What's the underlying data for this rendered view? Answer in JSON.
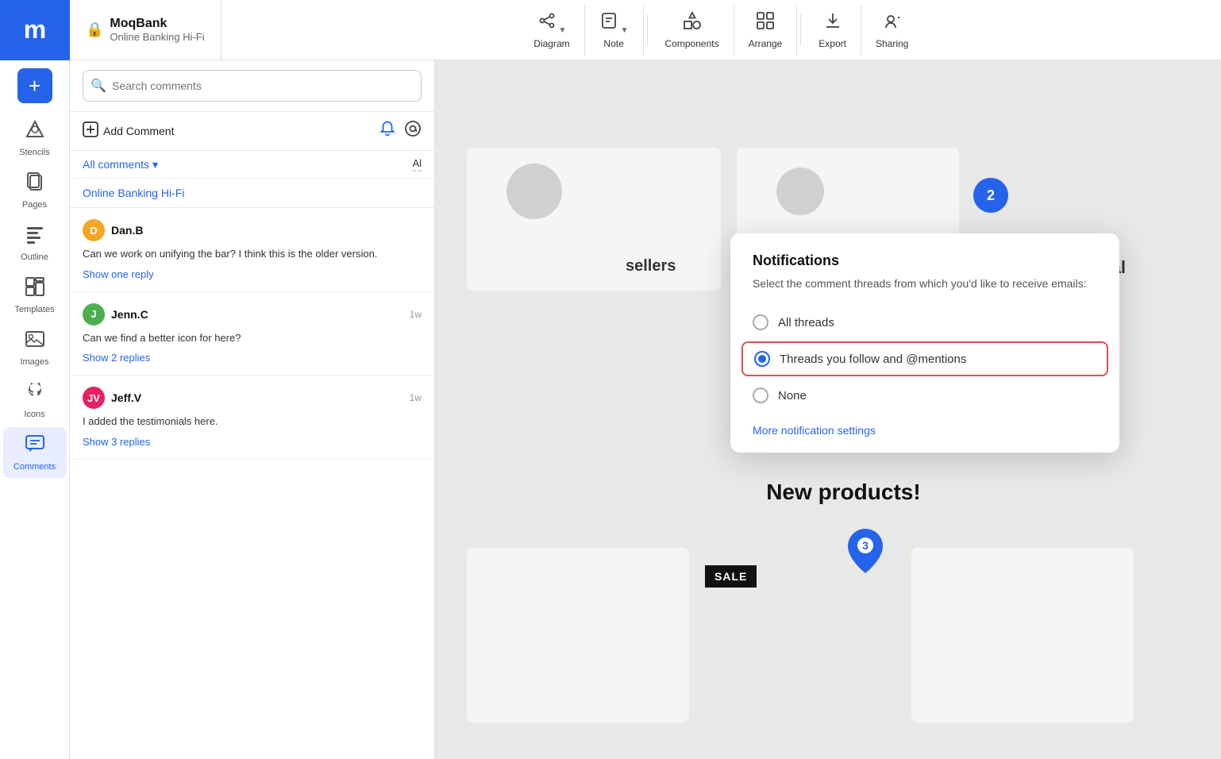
{
  "app": {
    "logo": "m",
    "project_name": "MoqBank",
    "project_sub": "Online Banking Hi-Fi",
    "lock_icon": "🔒"
  },
  "topbar": {
    "tools": [
      {
        "id": "diagram",
        "label": "Diagram",
        "icon": "⛓",
        "has_arrow": true
      },
      {
        "id": "note",
        "label": "Note",
        "icon": "📄",
        "has_arrow": true
      },
      {
        "id": "components",
        "label": "Components",
        "icon": "🔄"
      },
      {
        "id": "arrange",
        "label": "Arrange",
        "icon": "⊞"
      },
      {
        "id": "export",
        "label": "Export",
        "icon": "⬇"
      },
      {
        "id": "sharing",
        "label": "Sharing",
        "icon": "👤+"
      }
    ]
  },
  "sidebar": {
    "add_label": "+",
    "items": [
      {
        "id": "stencils",
        "label": "Stencils",
        "icon": "▲"
      },
      {
        "id": "pages",
        "label": "Pages",
        "icon": "📋"
      },
      {
        "id": "outline",
        "label": "Outline",
        "icon": "≡"
      },
      {
        "id": "templates",
        "label": "Templates",
        "icon": "⊞"
      },
      {
        "id": "images",
        "label": "Images",
        "icon": "🖼"
      },
      {
        "id": "icons",
        "label": "Icons",
        "icon": "♣"
      },
      {
        "id": "comments",
        "label": "Comments",
        "icon": "💬",
        "active": true
      }
    ]
  },
  "comments_panel": {
    "search_placeholder": "Search comments",
    "add_comment_label": "Add Comment",
    "all_comments_label": "All comments",
    "filter_label": "Al",
    "project_name": "Online Banking Hi-Fi",
    "comments": [
      {
        "id": "comment-1",
        "author": "Dan.B",
        "avatar_initials": "D",
        "avatar_color": "#f5a623",
        "time": "",
        "text": "Can we work on unifying the bar? I think this is the older version.",
        "replies_label": "Show one reply"
      },
      {
        "id": "comment-2",
        "author": "Jenn.C",
        "avatar_initials": "J",
        "avatar_color": "#4caf50",
        "time": "1w",
        "text": "Can we find a better icon for here?",
        "replies_label": "Show 2 replies"
      },
      {
        "id": "comment-3",
        "author": "Jeff.V",
        "avatar_initials": "JV",
        "avatar_color": "#e91e63",
        "time": "1w",
        "text": "I added the testimonials here.",
        "replies_label": "Show 3 replies"
      }
    ]
  },
  "canvas": {
    "badge_2_label": "2",
    "badge_3_label": "3",
    "text_sellers": "sellers",
    "text_seasonal": "Seasonal",
    "text_new_products": "New products!",
    "sale_badge_label": "SALE"
  },
  "notification_popup": {
    "title": "Notifications",
    "description": "Select the comment threads from which you'd like to receive emails:",
    "options": [
      {
        "id": "all-threads",
        "label": "All threads",
        "selected": false
      },
      {
        "id": "threads-follow",
        "label": "Threads you follow and @mentions",
        "selected": true
      },
      {
        "id": "none",
        "label": "None",
        "selected": false
      }
    ],
    "more_link_label": "More notification settings"
  }
}
